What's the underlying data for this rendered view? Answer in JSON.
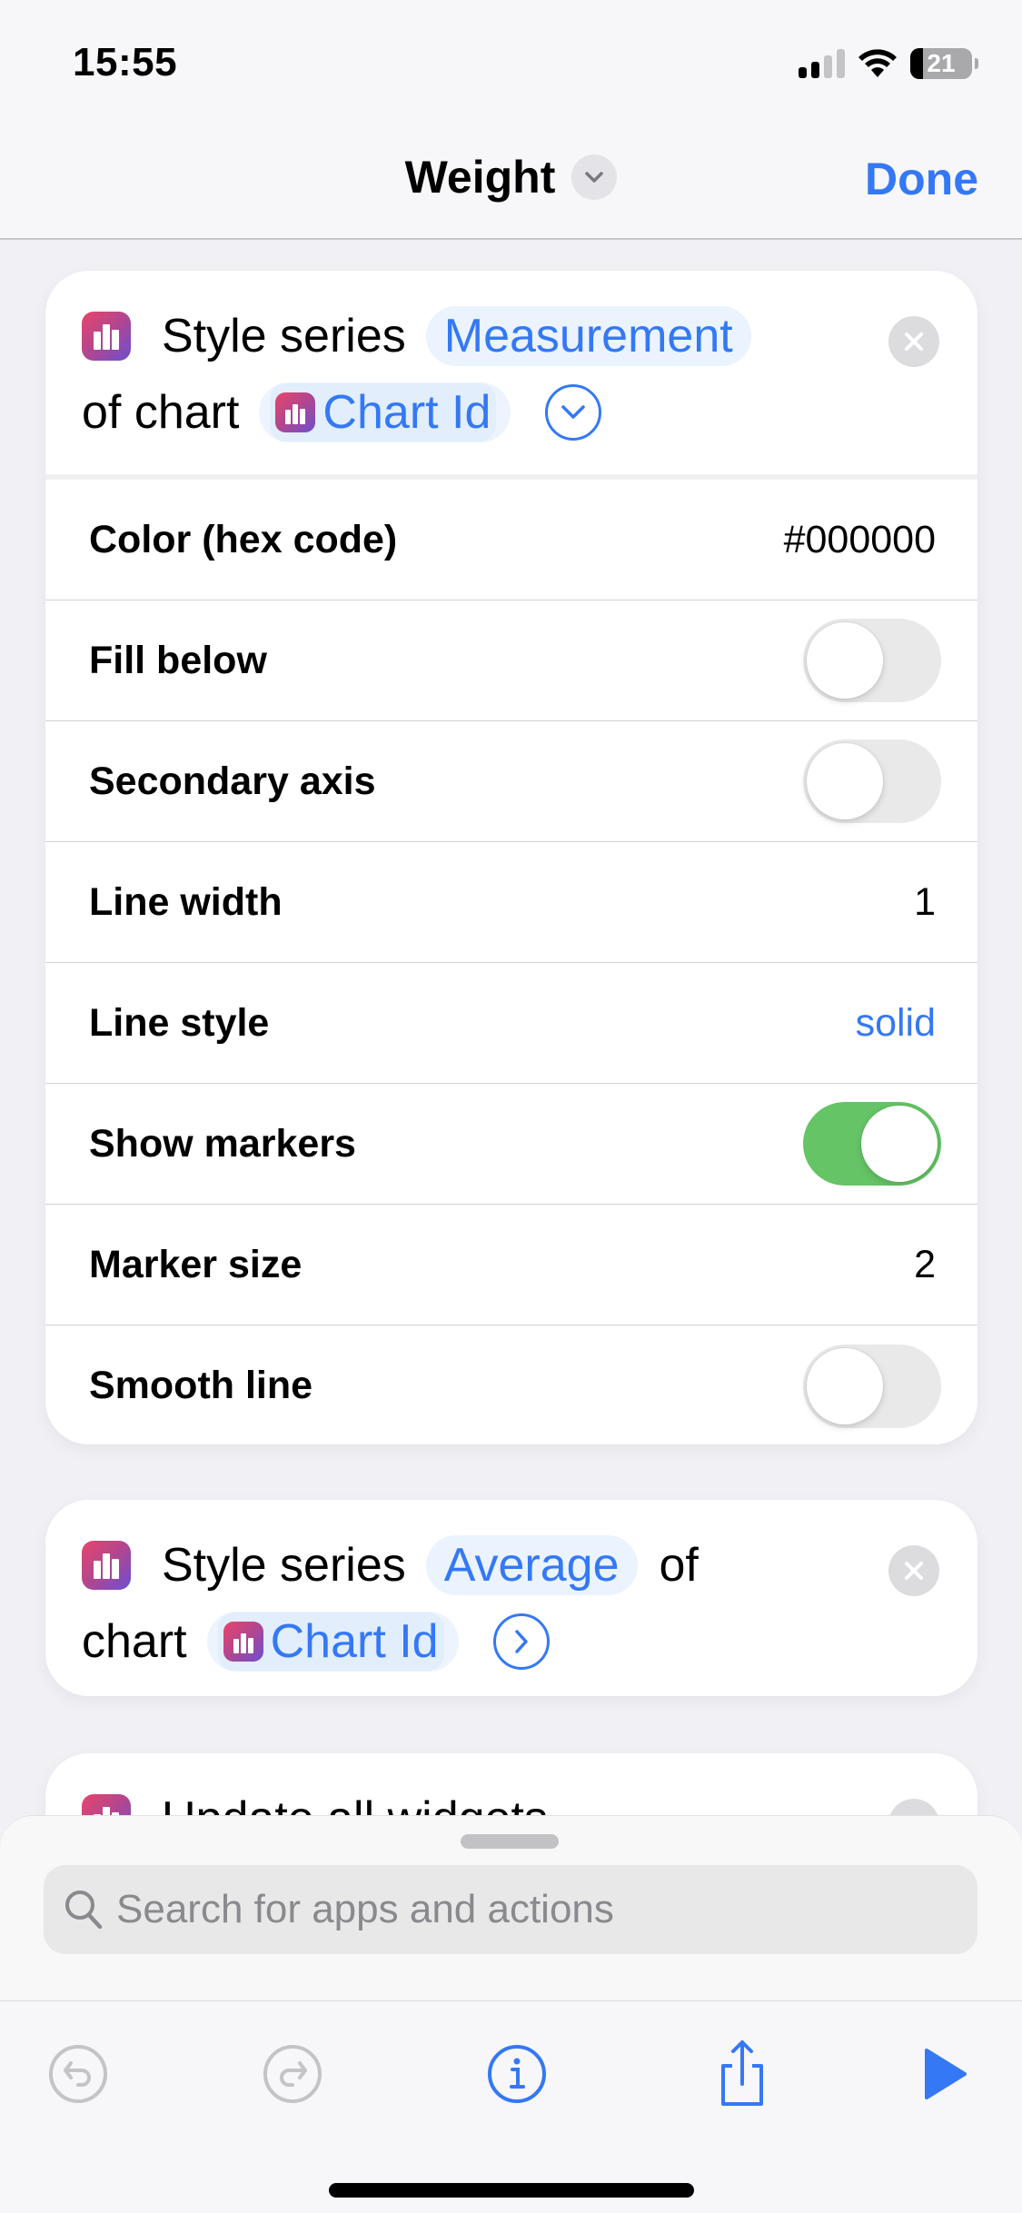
{
  "status_bar": {
    "time": "15:55",
    "signal_bars_active": 2,
    "signal_bars_total": 4,
    "battery_percent": 21,
    "battery_label": "21"
  },
  "nav": {
    "title": "Weight",
    "done_label": "Done"
  },
  "actions": [
    {
      "words_line1": [
        "Style series"
      ],
      "parameter": "Measurement",
      "words_line2": "of chart",
      "variable": "Chart Id",
      "expanded": true,
      "rows": [
        {
          "label": "Color (hex code)",
          "type": "value",
          "value": "#000000"
        },
        {
          "label": "Fill below",
          "type": "toggle",
          "on": false
        },
        {
          "label": "Secondary axis",
          "type": "toggle",
          "on": false
        },
        {
          "label": "Line width",
          "type": "value",
          "value": "1"
        },
        {
          "label": "Line style",
          "type": "link",
          "value": "solid"
        },
        {
          "label": "Show markers",
          "type": "toggle",
          "on": true
        },
        {
          "label": "Marker size",
          "type": "value",
          "value": "2"
        },
        {
          "label": "Smooth line",
          "type": "toggle",
          "on": false
        }
      ]
    },
    {
      "words_line1": [
        "Style series"
      ],
      "parameter": "Average",
      "trailing_word": "of",
      "words_line2": "chart",
      "variable": "Chart Id",
      "expanded": false
    },
    {
      "title": "Update all widgets"
    }
  ],
  "sheet": {
    "search_placeholder": "Search for apps and actions"
  },
  "toolbar": {
    "undo": "undo-icon",
    "redo": "redo-icon",
    "info": "info-icon",
    "share": "share-icon",
    "run": "play-icon"
  },
  "colors": {
    "accent": "#3478F6",
    "toggle_on": "#65C466",
    "toggle_off": "#E9E9EA",
    "app_icon_start": "#E8456A",
    "app_icon_end": "#6B4FD2"
  }
}
